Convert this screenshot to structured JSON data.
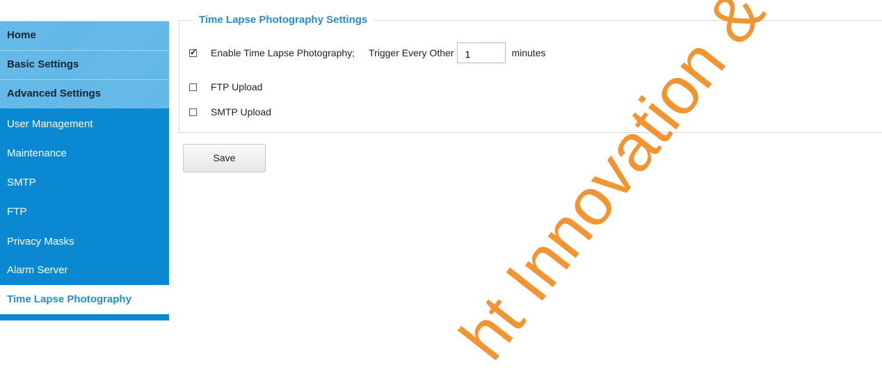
{
  "sidebar": {
    "headers": [
      "Home",
      "Basic Settings",
      "Advanced Settings"
    ],
    "items": [
      "User Management",
      "Maintenance",
      "SMTP",
      "FTP",
      "Privacy Masks",
      "Alarm Server",
      "Time Lapse Photography"
    ],
    "active_item": "Time Lapse Photography"
  },
  "panel": {
    "legend": "Time Lapse Photography Settings",
    "enable_label": "Enable Time Lapse Photography;",
    "enable_checked": true,
    "trigger_label": "Trigger Every Other",
    "trigger_value": "1",
    "trigger_unit": "minutes",
    "ftp_label": "FTP Upload",
    "ftp_checked": false,
    "smtp_label": "SMTP Upload",
    "smtp_checked": false
  },
  "save_label": "Save",
  "watermark": "ht Innovation & Te",
  "colors": {
    "sidebar_bg": "#0a88d1",
    "legend_text": "#2a8ac5",
    "watermark": "#f08a1e"
  }
}
